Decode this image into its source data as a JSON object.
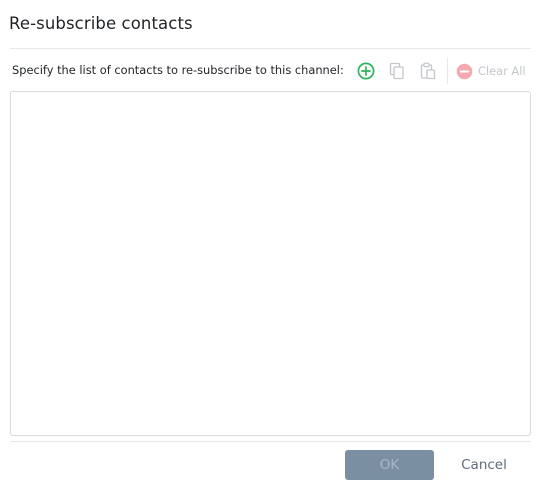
{
  "dialog": {
    "title": "Re-subscribe contacts",
    "instruction": "Specify the list of contacts to re-subscribe to this channel:"
  },
  "toolbar": {
    "add_icon": "plus-circle-icon",
    "copy_icon": "copy-icon",
    "paste_icon": "paste-icon",
    "clear_icon": "minus-circle-icon",
    "clear_all_label": "Clear All"
  },
  "contacts_list": {
    "items": []
  },
  "footer": {
    "ok_label": "OK",
    "cancel_label": "Cancel"
  },
  "colors": {
    "add_icon": "#2ab55a",
    "disabled_icon": "#c3c7cc",
    "clear_icon": "#f4a9b0",
    "ok_bg": "#7b8fa2",
    "cancel_text": "#5f6b7a"
  }
}
